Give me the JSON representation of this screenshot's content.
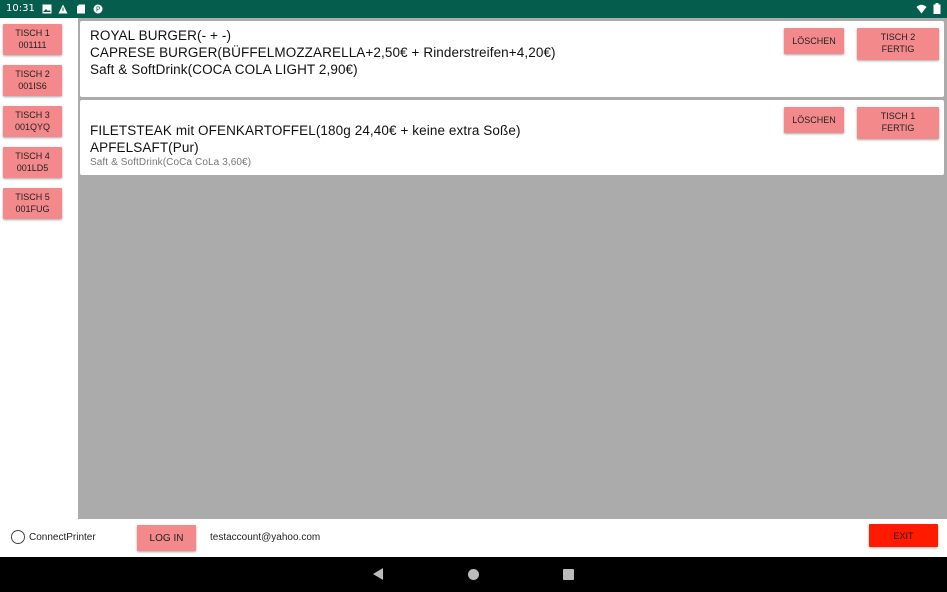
{
  "status": {
    "time": "10:31"
  },
  "tables": [
    {
      "name": "TISCH 1",
      "code": "001111"
    },
    {
      "name": "TISCH 2",
      "code": "001IS6"
    },
    {
      "name": "TISCH 3",
      "code": "001QYQ"
    },
    {
      "name": "TISCH 4",
      "code": "001LD5"
    },
    {
      "name": "TISCH 5",
      "code": "001FUG"
    }
  ],
  "orders": [
    {
      "lines": [
        "ROYAL BURGER(- + -)",
        "CAPRESE BURGER(BÜFFELMOZZARELLA+2,50€ + Rinderstreifen+4,20€)",
        "Saft & SoftDrink(COCA COLA LIGHT 2,90€)"
      ],
      "delete_label": "LÖSCHEN",
      "done_label_1": "TISCH 2",
      "done_label_2": "FERTIG"
    },
    {
      "lines": [
        "FILETSTEAK mit OFENKARTOFFEL(180g  24,40€ + keine extra Soße)",
        "APFELSAFT(Pur)"
      ],
      "small_line": "Saft & SoftDrink(CoCa CoLa 3,60€)",
      "delete_label": "LÖSCHEN",
      "done_label_1": "TISCH 1",
      "done_label_2": "FERTIG"
    }
  ],
  "bottom": {
    "printer_label": "ConnectPrinter",
    "login_label": "LOG IN",
    "account": "testaccount@yahoo.com",
    "exit_label": "EXIT"
  },
  "colors": {
    "statusbar": "#055e4d",
    "button": "#f4898c",
    "exit": "#ff1a00",
    "panel": "#ababab"
  }
}
